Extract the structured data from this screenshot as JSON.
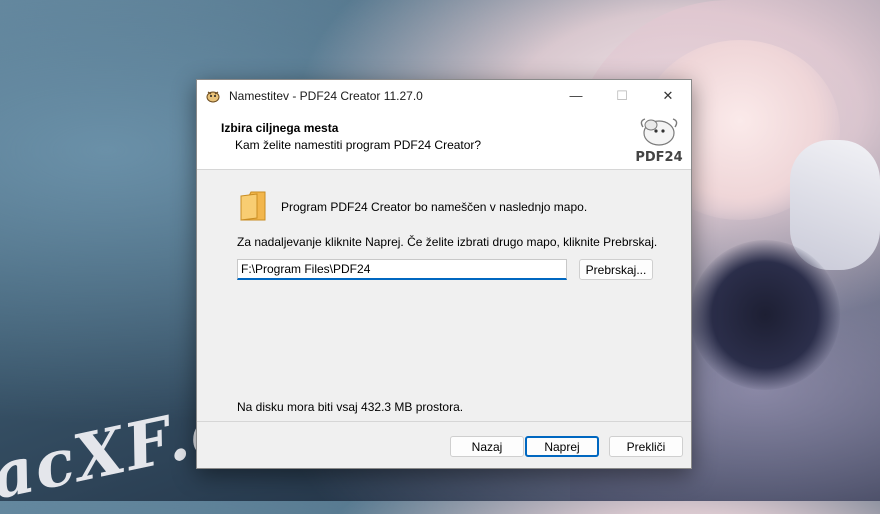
{
  "window": {
    "title": "Namestitev - PDF24 Creator 11.27.0",
    "controls": {
      "minimize": "—",
      "maximize": "☐",
      "close": "✕"
    }
  },
  "header": {
    "title": "Izbira ciljnega mesta",
    "subtitle": "Kam želite namestiti program PDF24 Creator?",
    "logo_text": "PDF24"
  },
  "content": {
    "install_info": "Program PDF24 Creator bo nameščen v naslednjo mapo.",
    "instructions": "Za nadaljevanje kliknite Naprej. Če želite izbrati drugo mapo, kliknite Prebrskaj.",
    "path_value": "F:\\Program Files\\PDF24",
    "browse_label": "Prebrskaj...",
    "disk_space": "Na disku mora biti vsaj 432.3 MB prostora."
  },
  "footer": {
    "back_label": "Nazaj",
    "next_label": "Naprej",
    "cancel_label": "Prekliči"
  },
  "background": {
    "watermark": "acXF.c"
  },
  "colors": {
    "accent": "#0067c0",
    "dialog_bg": "#f0f0f0",
    "header_bg": "#ffffff",
    "folder": "#f2b64c"
  }
}
